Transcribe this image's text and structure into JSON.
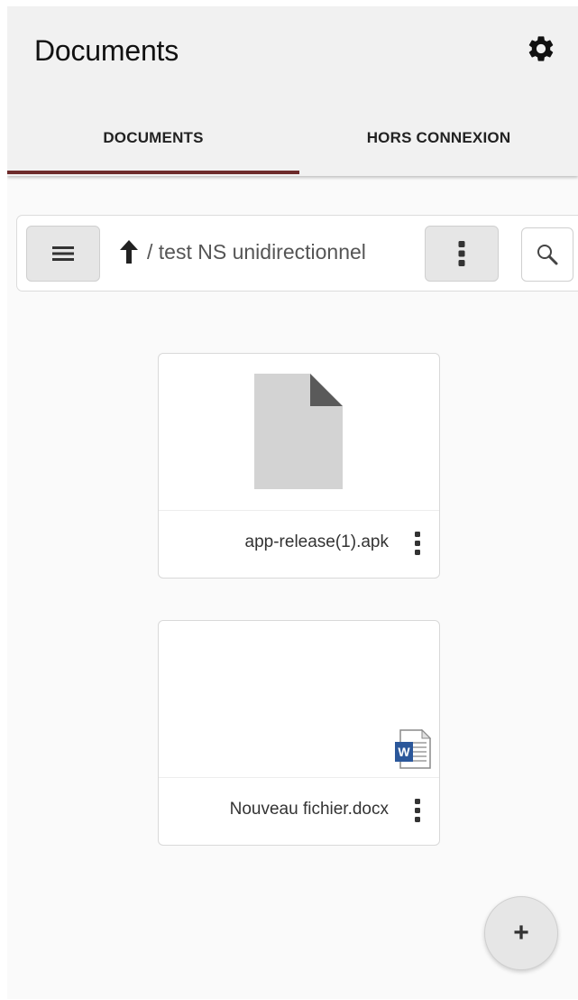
{
  "appbar": {
    "title": "Documents",
    "settings_icon": "gear-icon"
  },
  "tabs": [
    {
      "label": "DOCUMENTS",
      "selected": true
    },
    {
      "label": "HORS CONNEXION",
      "selected": false
    }
  ],
  "toolbar": {
    "menu_icon": "hamburger-menu-icon",
    "up_icon": "arrow-up-icon",
    "path": "/ test NS unidirectionnel",
    "more_icon": "vertical-dots-icon",
    "search_icon": "search-icon"
  },
  "files": [
    {
      "name": "app-release(1).apk",
      "preview_icon": "generic-file-icon",
      "menu_icon": "vertical-dots-icon"
    },
    {
      "name": "Nouveau fichier.docx",
      "preview_icon": "word-document-icon",
      "menu_icon": "vertical-dots-icon"
    }
  ],
  "fab": {
    "label": "+"
  },
  "colors": {
    "accent": "#6d2b2b",
    "appbar_bg": "#f1f1f1",
    "button_bg": "#e6e6e6",
    "word_blue": "#2b579a"
  }
}
